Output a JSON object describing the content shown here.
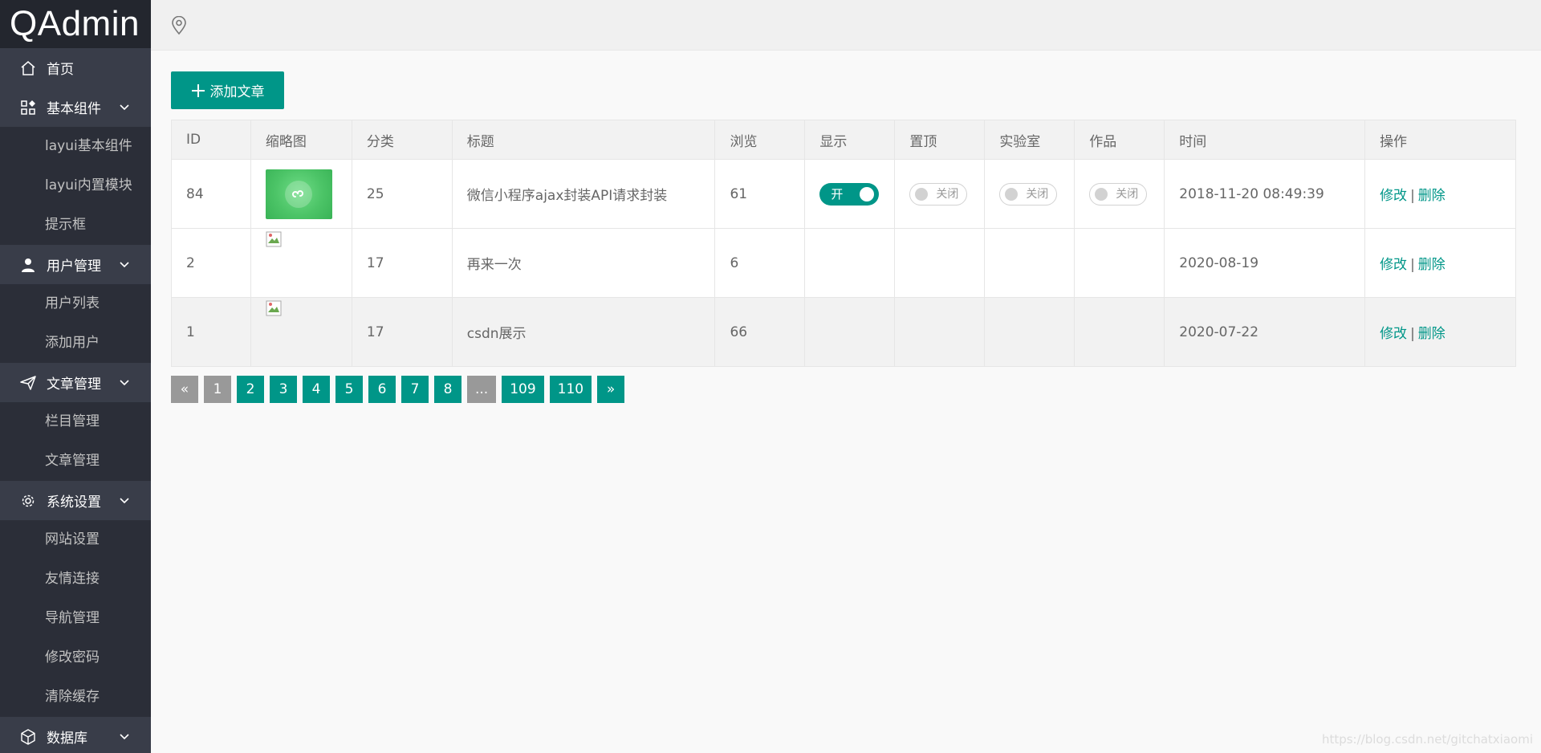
{
  "app": {
    "logo": "QAdmin"
  },
  "sidebar": {
    "home": "首页",
    "groups": [
      {
        "label": "基本组件",
        "items": [
          "layui基本组件",
          "layui内置模块",
          "提示框"
        ]
      },
      {
        "label": "用户管理",
        "items": [
          "用户列表",
          "添加用户"
        ]
      },
      {
        "label": "文章管理",
        "items": [
          "栏目管理",
          "文章管理"
        ]
      },
      {
        "label": "系统设置",
        "items": [
          "网站设置",
          "友情连接",
          "导航管理",
          "修改密码",
          "清除缓存"
        ]
      },
      {
        "label": "数据库",
        "items": []
      }
    ]
  },
  "toolbar": {
    "add_label": "添加文章"
  },
  "table": {
    "headers": [
      "ID",
      "缩略图",
      "分类",
      "标题",
      "浏览",
      "显示",
      "置顶",
      "实验室",
      "作品",
      "时间",
      "操作"
    ],
    "rows": [
      {
        "id": "84",
        "category": "25",
        "title": "微信小程序ajax封装API请求封装",
        "views": "61",
        "show": "开",
        "top": "关闭",
        "lab": "关闭",
        "works": "关闭",
        "time": "2018-11-20 08:49:39",
        "edit": "修改",
        "delete": "删除"
      },
      {
        "id": "2",
        "category": "17",
        "title": "再来一次",
        "views": "6",
        "time": "2020-08-19",
        "edit": "修改",
        "delete": "删除"
      },
      {
        "id": "1",
        "category": "17",
        "title": "csdn展示",
        "views": "66",
        "time": "2020-07-22",
        "edit": "修改",
        "delete": "删除"
      }
    ],
    "separator": "|"
  },
  "pager": {
    "prev": "«",
    "pages": [
      "1",
      "2",
      "3",
      "4",
      "5",
      "6",
      "7",
      "8",
      "...",
      "109",
      "110"
    ],
    "next": "»"
  },
  "watermark": "https://blog.csdn.net/gitchatxiaomi",
  "colors": {
    "accent": "#009688",
    "sidebar": "#393d49",
    "sidebar_sub": "#2b2e38",
    "logo_bg": "#23262e"
  }
}
